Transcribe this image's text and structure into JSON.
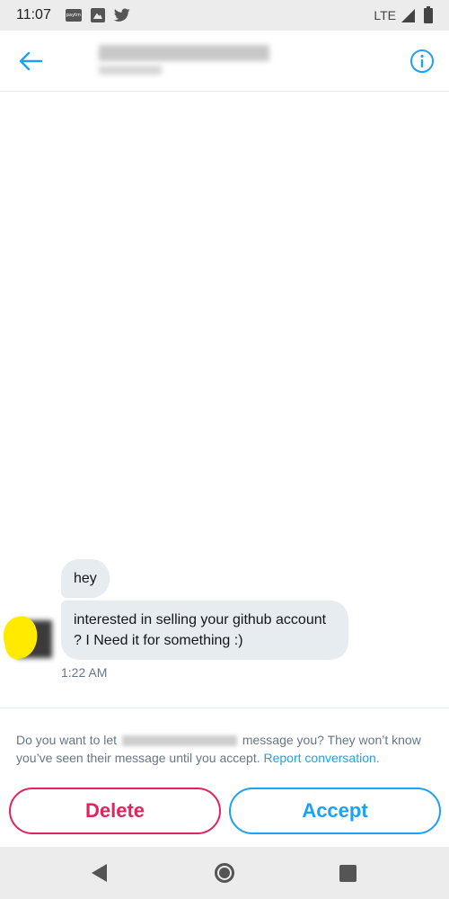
{
  "status_bar": {
    "time": "11:07",
    "network": "LTE",
    "icons": [
      "paytm-icon",
      "gallery-icon",
      "twitter-icon",
      "signal-icon",
      "battery-icon"
    ]
  },
  "header": {
    "back_icon": "back-arrow-icon",
    "info_icon": "info-icon"
  },
  "messages": [
    {
      "text": "hey"
    },
    {
      "text": "interested in selling your github account ? I Need it for something :)"
    }
  ],
  "message_time": "1:22 AM",
  "request": {
    "text_before": "Do you want to let",
    "text_after": "message you? They won’t know you’ve seen their message until you accept.",
    "report_link": "Report conversation."
  },
  "actions": {
    "delete_label": "Delete",
    "accept_label": "Accept"
  },
  "colors": {
    "accent": "#1da1f2",
    "danger": "#e0245e",
    "bubble": "#e6ecf0",
    "secondary_text": "#657786"
  },
  "nav_bar": {
    "icons": [
      "nav-back-icon",
      "nav-home-icon",
      "nav-recents-icon"
    ]
  }
}
